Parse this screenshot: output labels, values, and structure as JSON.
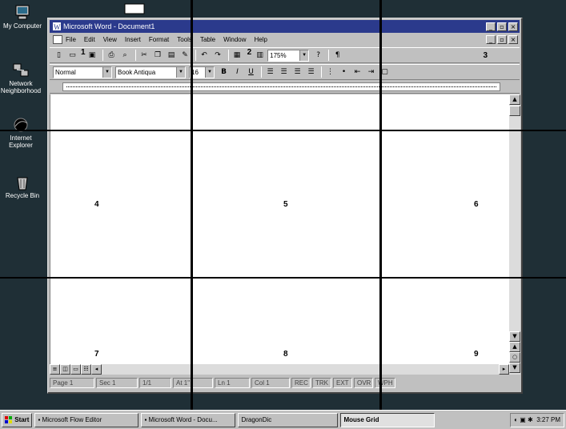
{
  "desktop": {
    "icons": [
      {
        "label": "My Computer",
        "icon": "computer-icon"
      },
      {
        "label": "Network Neighborhood",
        "icon": "network-icon"
      },
      {
        "label": "Internet Explorer",
        "icon": "internet-explorer-icon"
      },
      {
        "label": "Recycle Bin",
        "icon": "recycle-bin-icon"
      }
    ]
  },
  "window": {
    "title": "Microsoft Word - Document1",
    "menu": [
      "File",
      "Edit",
      "View",
      "Insert",
      "Format",
      "Tools",
      "Table",
      "Window",
      "Help"
    ],
    "toolbar1": {
      "zoom": "175%",
      "callout_1": "1",
      "callout_2": "2",
      "callout_3": "3"
    },
    "toolbar2": {
      "style": "Normal",
      "font": "Book Antiqua",
      "size": "16"
    },
    "status": {
      "page": "Page 1",
      "sec": "Sec 1",
      "pos": "1/1",
      "at": "At 1\"",
      "ln": "Ln 1",
      "col": "Col 1",
      "rec": "REC",
      "trk": "TRK",
      "ext": "EXT",
      "ovr": "OVR",
      "wph": "WPH"
    }
  },
  "grid_numbers": [
    "1",
    "2",
    "3",
    "4",
    "5",
    "6",
    "7",
    "8",
    "9"
  ],
  "taskbar": {
    "start": "Start",
    "tasks": [
      "Microsoft Flow Editor",
      "Microsoft Word - Docu...",
      "DragonDic"
    ],
    "active_task": "Mouse Grid",
    "clock": "3:27 PM"
  }
}
